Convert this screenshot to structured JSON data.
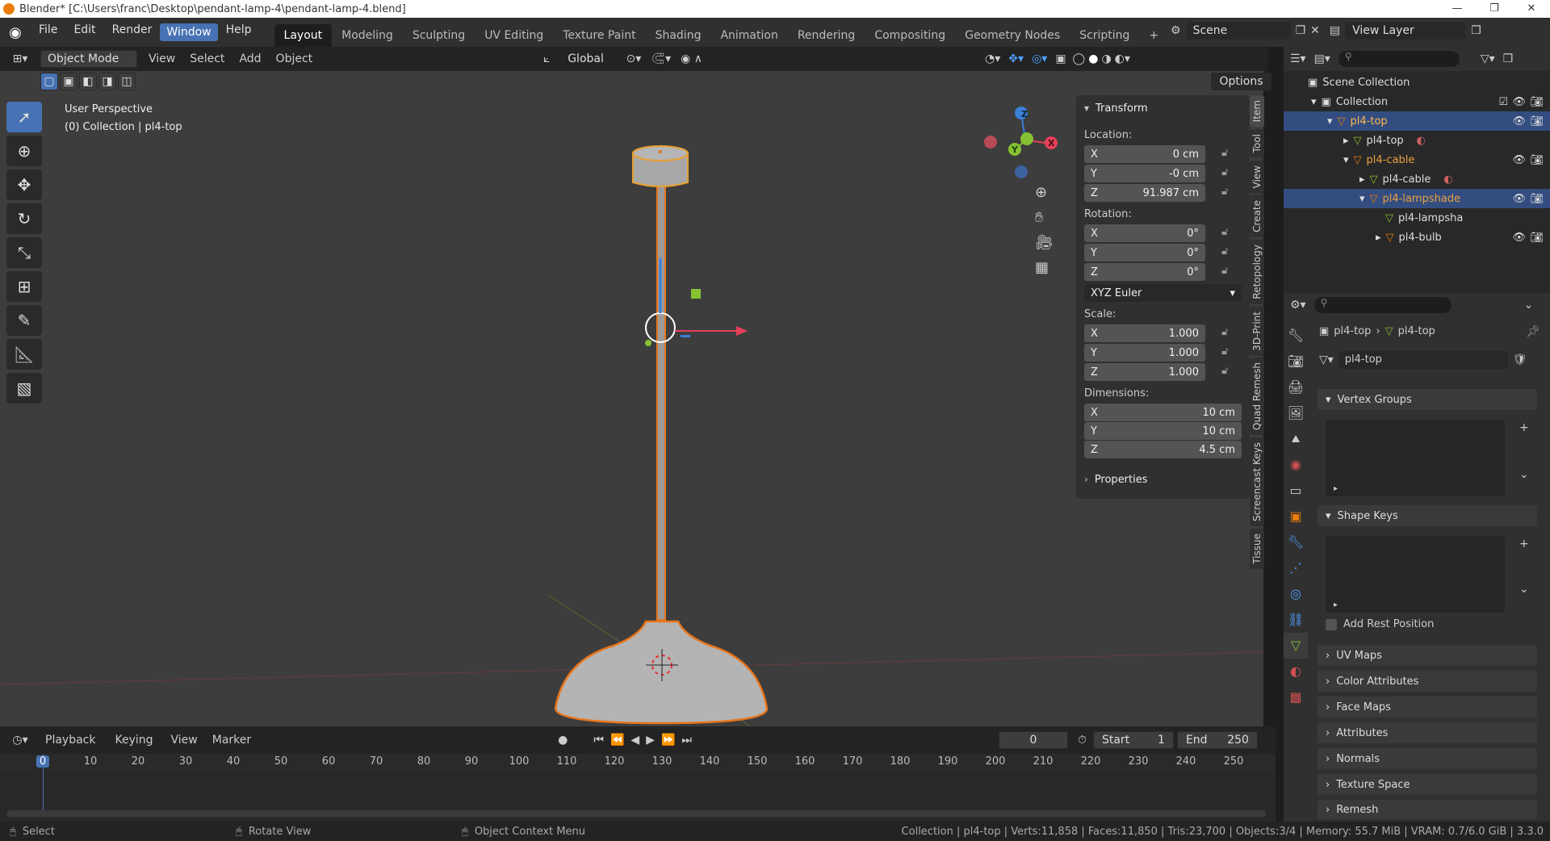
{
  "titlebar": {
    "title": "Blender* [C:\\Users\\franc\\Desktop\\pendant-lamp-4\\pendant-lamp-4.blend]",
    "minimize": "—",
    "maximize": "❐",
    "close": "✕"
  },
  "menu": [
    "File",
    "Edit",
    "Render",
    "Window",
    "Help"
  ],
  "menu_active": "Window",
  "workspaces": [
    "Layout",
    "Modeling",
    "Sculpting",
    "UV Editing",
    "Texture Paint",
    "Shading",
    "Animation",
    "Rendering",
    "Compositing",
    "Geometry Nodes",
    "Scripting"
  ],
  "workspace_active": "Layout",
  "scene": {
    "label": "Scene",
    "view_layer": "View Layer"
  },
  "viewport_header": {
    "mode": "Object Mode",
    "menus": [
      "View",
      "Select",
      "Add",
      "Object"
    ],
    "orientation": "Global",
    "options": "Options"
  },
  "viewport": {
    "perspective": "User Perspective",
    "context": "(0) Collection | pl4-top",
    "gizmo": {
      "x": "X",
      "y": "Y",
      "z": "Z"
    }
  },
  "npanel": {
    "transform": "Transform",
    "location_label": "Location:",
    "location": [
      {
        "axis": "X",
        "value": "0 cm"
      },
      {
        "axis": "Y",
        "value": "-0 cm"
      },
      {
        "axis": "Z",
        "value": "91.987 cm"
      }
    ],
    "rotation_label": "Rotation:",
    "rotation": [
      {
        "axis": "X",
        "value": "0°"
      },
      {
        "axis": "Y",
        "value": "0°"
      },
      {
        "axis": "Z",
        "value": "0°"
      }
    ],
    "rotation_mode": "XYZ Euler",
    "scale_label": "Scale:",
    "scale": [
      {
        "axis": "X",
        "value": "1.000"
      },
      {
        "axis": "Y",
        "value": "1.000"
      },
      {
        "axis": "Z",
        "value": "1.000"
      }
    ],
    "dimensions_label": "Dimensions:",
    "dimensions": [
      {
        "axis": "X",
        "value": "10 cm"
      },
      {
        "axis": "Y",
        "value": "10 cm"
      },
      {
        "axis": "Z",
        "value": "4.5 cm"
      }
    ],
    "properties": "Properties"
  },
  "vtabs": [
    "Item",
    "Tool",
    "View",
    "Create",
    "Retopology",
    "3D-Print",
    "Quad Remesh",
    "Screencast Keys",
    "Tissue"
  ],
  "outliner": {
    "rows": [
      {
        "label": "Scene Collection"
      },
      {
        "label": "Collection"
      },
      {
        "label": "pl4-top"
      },
      {
        "label": "pl4-top"
      },
      {
        "label": "pl4-cable"
      },
      {
        "label": "pl4-cable"
      },
      {
        "label": "pl4-lampshade"
      },
      {
        "label": "pl4-lampsha"
      },
      {
        "label": "pl4-bulb"
      }
    ]
  },
  "props": {
    "breadcrumb_obj": "pl4-top",
    "breadcrumb_data": "pl4-top",
    "mesh_name": "pl4-top",
    "sections": [
      "Vertex Groups",
      "Shape Keys"
    ],
    "add_rest_position": "Add Rest Position",
    "collapsed": [
      "UV Maps",
      "Color Attributes",
      "Face Maps",
      "Attributes",
      "Normals",
      "Texture Space",
      "Remesh"
    ]
  },
  "timeline": {
    "menus": [
      "Playback",
      "Keying",
      "View",
      "Marker"
    ],
    "current": "0",
    "start_label": "Start",
    "start": "1",
    "end_label": "End",
    "end": "250",
    "ticks": [
      "0",
      "10",
      "20",
      "30",
      "40",
      "50",
      "60",
      "70",
      "80",
      "90",
      "100",
      "110",
      "120",
      "130",
      "140",
      "150",
      "160",
      "170",
      "180",
      "190",
      "200",
      "210",
      "220",
      "230",
      "240",
      "250"
    ]
  },
  "status": {
    "select": "Select",
    "rotate": "Rotate View",
    "context": "Object Context Menu",
    "info": "Collection | pl4-top | Verts:11,858 | Faces:11,850 | Tris:23,700 | Objects:3/4 | Memory: 55.7 MiB | VRAM: 0.7/6.0 GiB | 3.3.0"
  },
  "colors": {
    "accent": "#4772b3",
    "selected": "#e87d0d",
    "x_axis": "#e8405a",
    "y_axis": "#86c131",
    "z_axis": "#3b7fd9"
  }
}
